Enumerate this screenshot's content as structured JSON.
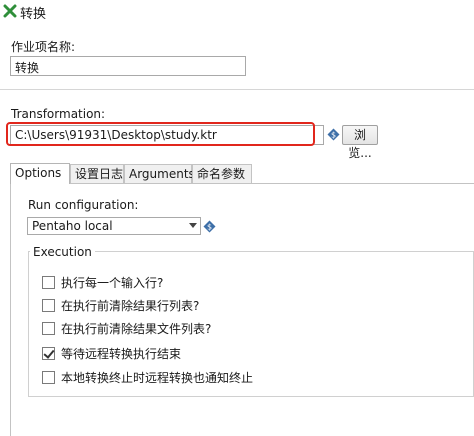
{
  "window": {
    "title": "转换"
  },
  "job_entry": {
    "name_label": "作业项名称:",
    "name_value": "转换"
  },
  "transformation": {
    "label": "Transformation:",
    "path_value": "C:\\Users\\91931\\Desktop\\study.ktr",
    "browse_label": "浏览..."
  },
  "tabs": [
    {
      "label": "Options",
      "active": true
    },
    {
      "label": "设置日志",
      "active": false
    },
    {
      "label": "Arguments",
      "active": false
    },
    {
      "label": "命名参数",
      "active": false
    }
  ],
  "options": {
    "run_config_label": "Run configuration:",
    "run_config_value": "Pentaho local",
    "execution_legend": "Execution",
    "checkboxes": [
      {
        "label": "执行每一个输入行?",
        "checked": false
      },
      {
        "label": "在执行前清除结果行列表?",
        "checked": false
      },
      {
        "label": "在执行前清除结果文件列表?",
        "checked": false
      },
      {
        "label": "等待远程转换执行结束",
        "checked": true
      },
      {
        "label": "本地转换终止时远程转换也通知终止",
        "checked": false
      }
    ]
  },
  "colors": {
    "highlight": "#e1261c",
    "variable_icon": "#3d6fa8"
  },
  "icons": {
    "title": "transformation-cross-icon",
    "variable": "variable-diamond-icon"
  }
}
